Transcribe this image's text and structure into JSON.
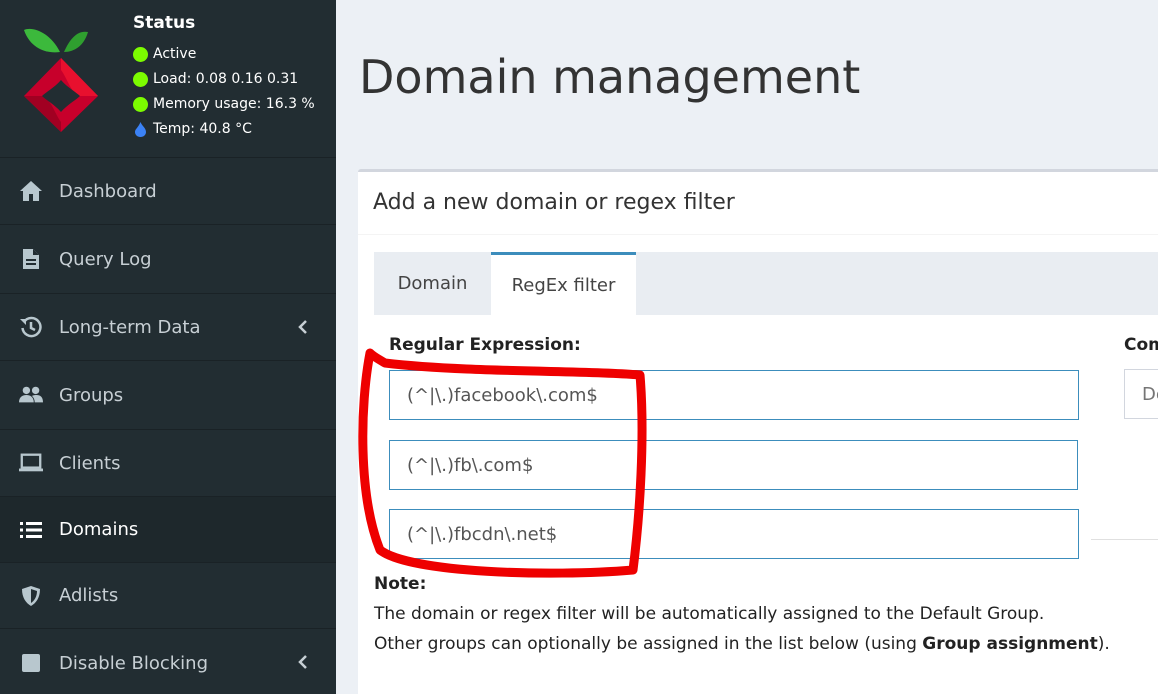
{
  "status": {
    "title": "Status",
    "active": "Active",
    "load": "Load:  0.08  0.16  0.31",
    "memory": "Memory usage:  16.3 %",
    "temp": "Temp: 40.8 °C"
  },
  "menu": {
    "items": [
      {
        "label": "Dashboard",
        "icon": "home-icon"
      },
      {
        "label": "Query Log",
        "icon": "file-icon"
      },
      {
        "label": "Long-term Data",
        "icon": "history-icon"
      },
      {
        "label": "Groups",
        "icon": "users-icon"
      },
      {
        "label": "Clients",
        "icon": "laptop-icon"
      },
      {
        "label": "Domains",
        "icon": "list-icon"
      },
      {
        "label": "Adlists",
        "icon": "shield-icon"
      },
      {
        "label": "Disable Blocking",
        "icon": "stop-icon"
      }
    ]
  },
  "page": {
    "title": "Domain management"
  },
  "form": {
    "box_title": "Add a new domain or regex filter",
    "tabs": [
      "Domain",
      "RegEx filter"
    ],
    "regex_label": "Regular Expression:",
    "comment_label": "Com",
    "comment_placeholder": "De",
    "regex_values": [
      "(^|\\.)facebook\\.com$",
      "(^|\\.)fb\\.com$",
      "(^|\\.)fbcdn\\.net$"
    ],
    "note_title": "Note:",
    "note_line1": "The domain or regex filter will be automatically assigned to the Default Group.",
    "note_line2_prefix": "Other groups can optionally be assigned in the list below (using ",
    "note_line2_bold": "Group assignment",
    "note_line2_suffix": ")."
  },
  "colors": {
    "sidebar_bg": "#222d32",
    "status_green": "#7CFC00",
    "tab_accent": "#3c8dbc",
    "annotation_red": "#ee0000"
  }
}
